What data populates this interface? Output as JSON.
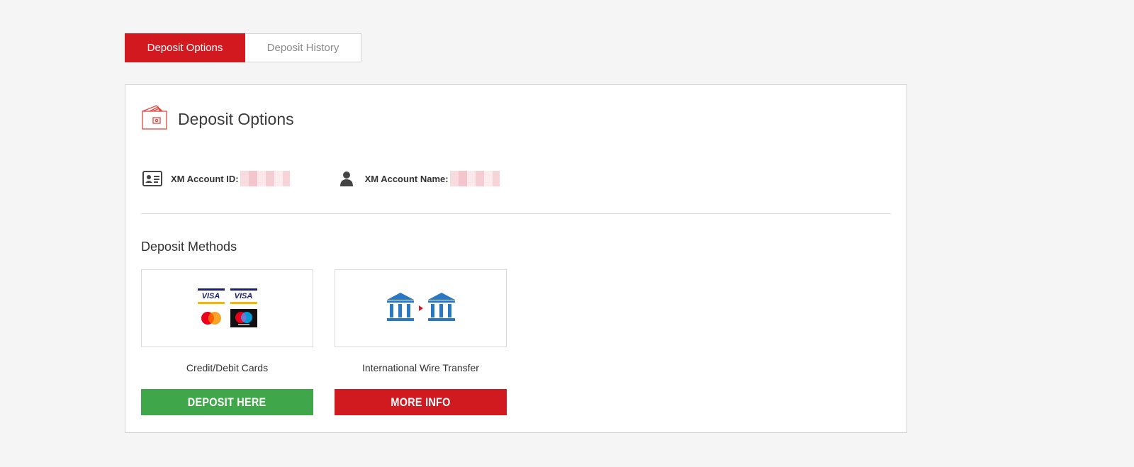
{
  "tabs": {
    "options_label": "Deposit Options",
    "history_label": "Deposit History"
  },
  "card": {
    "title": "Deposit Options",
    "account_id_label": "XM Account ID:",
    "account_name_label": "XM Account Name:",
    "methods_title": "Deposit Methods"
  },
  "methods": [
    {
      "name": "Credit/Debit Cards",
      "button_label": "DEPOSIT HERE",
      "button_color": "#3fa74a"
    },
    {
      "name": "International Wire Transfer",
      "button_label": "MORE INFO",
      "button_color": "#d01a1f"
    }
  ],
  "logos": {
    "visa_text": "VISA"
  },
  "colors": {
    "brand_red": "#d31920",
    "green": "#3fa74a",
    "bank_blue": "#2a78c2"
  },
  "icons": {
    "header": "wallet-icon",
    "account_id": "id-card-icon",
    "account_name": "user-icon",
    "wire": "bank-transfer-icon"
  }
}
